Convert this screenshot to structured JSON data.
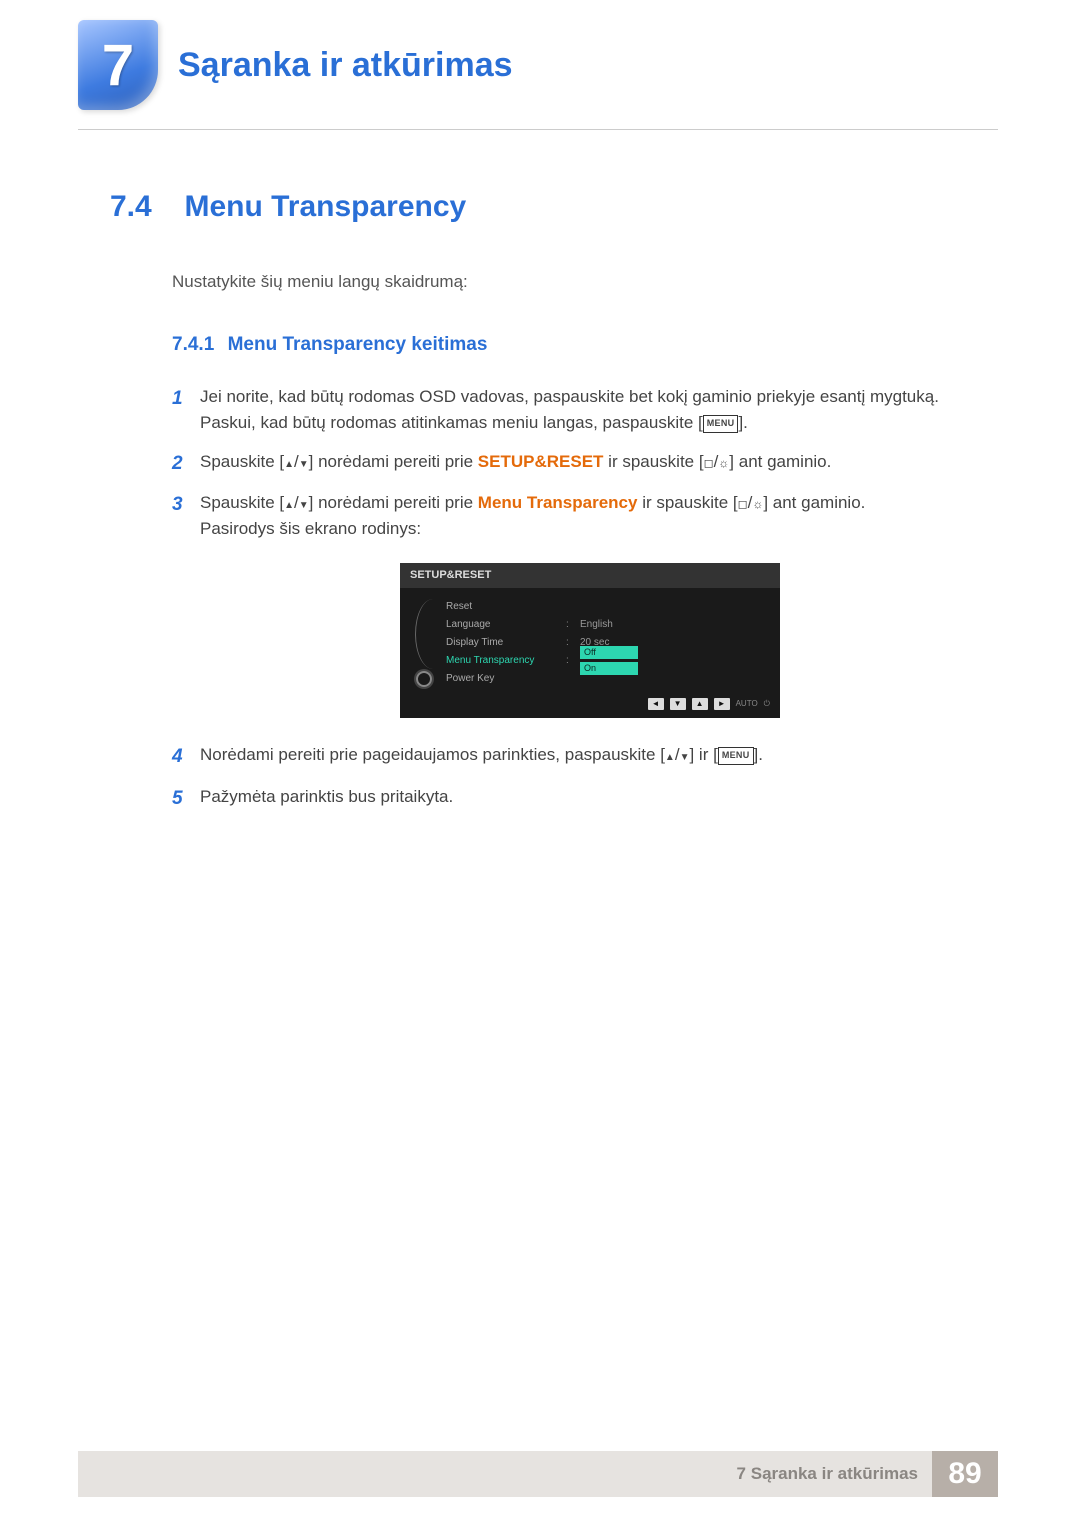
{
  "chapter": {
    "number": "7",
    "title": "Sąranka ir atkūrimas"
  },
  "section": {
    "number": "7.4",
    "title": "Menu Transparency"
  },
  "intro": "Nustatykite šių meniu langų skaidrumą:",
  "subsection": {
    "number": "7.4.1",
    "title": "Menu Transparency keitimas"
  },
  "steps": {
    "s1": {
      "line1": "Jei norite, kad būtų rodomas OSD vadovas, paspauskite bet kokį gaminio priekyje esantį mygtuką.",
      "line2a": "Paskui, kad būtų rodomas atitinkamas meniu langas, paspauskite [",
      "line2b": "].",
      "menu": "MENU"
    },
    "s2": {
      "a": "Spauskite [",
      "b": "] norėdami pereiti prie ",
      "orange": "SETUP&RESET",
      "c": " ir spauskite [",
      "d": "] ant gaminio."
    },
    "s3": {
      "a": "Spauskite [",
      "b": "] norėdami pereiti prie ",
      "orange": "Menu Transparency",
      "c": " ir spauskite [",
      "d": "] ant gaminio.",
      "e": "Pasirodys šis ekrano rodinys:"
    },
    "s4": {
      "a": "Norėdami pereiti prie pageidaujamos parinkties, paspauskite [",
      "b": "] ir [",
      "c": "].",
      "menu": "MENU"
    },
    "s5": {
      "text": "Pažymėta parinktis bus pritaikyta."
    }
  },
  "osd": {
    "title": "SETUP&RESET",
    "rows": {
      "reset": "Reset",
      "language": "Language",
      "language_val": "English",
      "display_time": "Display Time",
      "display_time_val": "20 sec",
      "menu_transparency": "Menu Transparency",
      "opt_off": "Off",
      "opt_on": "On",
      "power_key": "Power Key"
    },
    "bottom_auto": "AUTO"
  },
  "footer": {
    "text": "7 Sąranka ir atkūrimas",
    "page": "89"
  }
}
